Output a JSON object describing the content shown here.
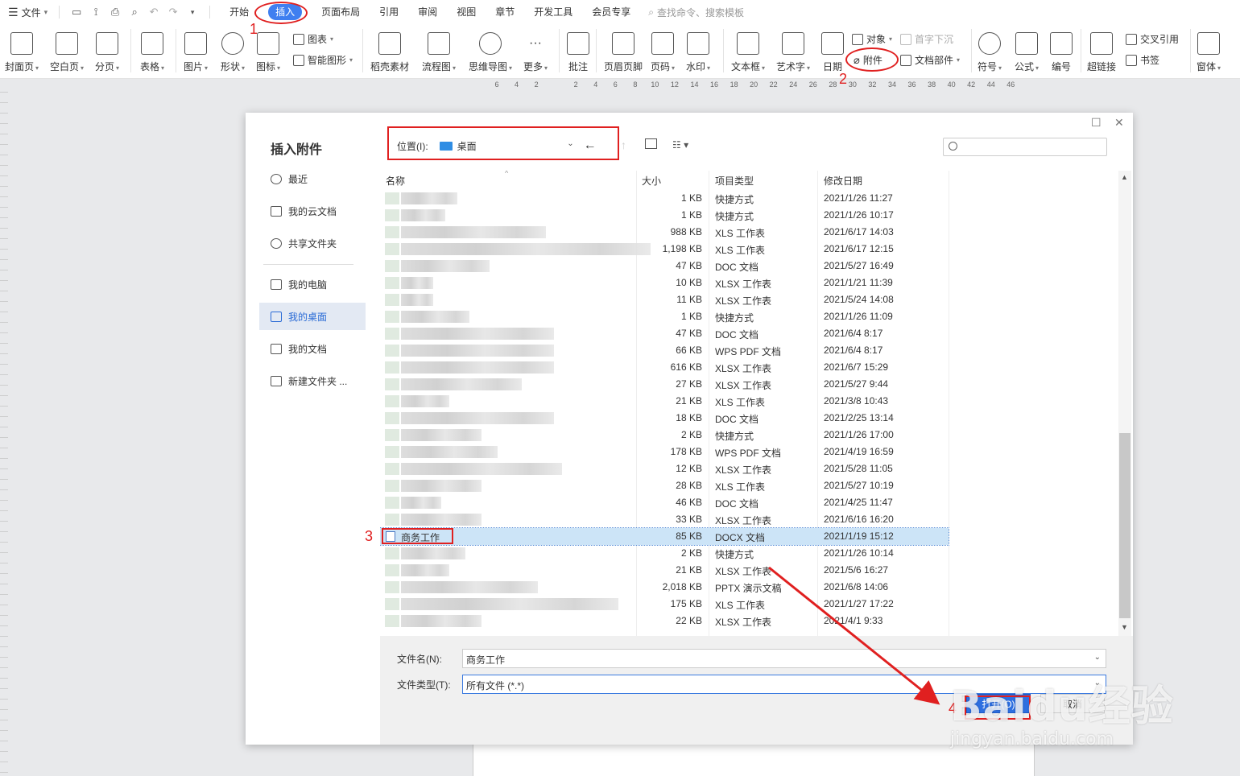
{
  "menubar": {
    "file_label": "文件",
    "tabs": [
      "开始",
      "插入",
      "页面布局",
      "引用",
      "审阅",
      "视图",
      "章节",
      "开发工具",
      "会员专享"
    ],
    "active_tab": "插入",
    "search_placeholder": "查找命令、搜索模板"
  },
  "ribbon": {
    "cover": "封面页",
    "blank": "空白页",
    "pagebreak": "分页",
    "table": "表格",
    "picture": "图片",
    "shape": "形状",
    "icon": "图标",
    "chart": "图表",
    "smartart": "智能图形",
    "material": "稻壳素材",
    "flowchart": "流程图",
    "mindmap": "思维导图",
    "more": "更多",
    "comment": "批注",
    "headerfooter": "页眉页脚",
    "pagenum": "页码",
    "watermark": "水印",
    "textbox": "文本框",
    "wordart": "艺术字",
    "date": "日期",
    "object": "对象",
    "attachment": "附件",
    "dropcap": "首字下沉",
    "docpart": "文档部件",
    "symbol": "符号",
    "formula": "公式",
    "numbering": "编号",
    "hyperlink": "超链接",
    "crossref": "交叉引用",
    "bookmark": "书签",
    "window": "窗体"
  },
  "ruler_ticks": [
    "6",
    "4",
    "2",
    "",
    "2",
    "4",
    "6",
    "8",
    "10",
    "12",
    "14",
    "16",
    "18",
    "20",
    "22",
    "24",
    "26",
    "28",
    "30",
    "32",
    "34",
    "36",
    "38",
    "40",
    "42",
    "44",
    "46"
  ],
  "annotations": [
    "1",
    "2",
    "3",
    "4"
  ],
  "dialog": {
    "title": "插入附件",
    "location_label": "位置(I):",
    "location_value": "桌面",
    "sidebar": [
      "最近",
      "我的云文档",
      "共享文件夹",
      "我的电脑",
      "我的桌面",
      "我的文档",
      "新建文件夹 ..."
    ],
    "columns": [
      "名称",
      "大小",
      "项目类型",
      "修改日期"
    ],
    "files": [
      {
        "size": "1 KB",
        "type": "快捷方式",
        "date": "2021/1/26 11:27"
      },
      {
        "size": "1 KB",
        "type": "快捷方式",
        "date": "2021/1/26 10:17"
      },
      {
        "size": "988 KB",
        "type": "XLS 工作表",
        "date": "2021/6/17 14:03"
      },
      {
        "size": "1,198 KB",
        "type": "XLS 工作表",
        "date": "2021/6/17 12:15"
      },
      {
        "size": "47 KB",
        "type": "DOC 文档",
        "date": "2021/5/27 16:49"
      },
      {
        "size": "10 KB",
        "type": "XLSX 工作表",
        "date": "2021/1/21 11:39"
      },
      {
        "size": "11 KB",
        "type": "XLSX 工作表",
        "date": "2021/5/24 14:08"
      },
      {
        "size": "1 KB",
        "type": "快捷方式",
        "date": "2021/1/26 11:09"
      },
      {
        "size": "47 KB",
        "type": "DOC 文档",
        "date": "2021/6/4 8:17"
      },
      {
        "size": "66 KB",
        "type": "WPS PDF 文档",
        "date": "2021/6/4 8:17"
      },
      {
        "size": "616 KB",
        "type": "XLSX 工作表",
        "date": "2021/6/7 15:29"
      },
      {
        "size": "27 KB",
        "type": "XLSX 工作表",
        "date": "2021/5/27 9:44"
      },
      {
        "size": "21 KB",
        "type": "XLS 工作表",
        "date": "2021/3/8 10:43"
      },
      {
        "size": "18 KB",
        "type": "DOC 文档",
        "date": "2021/2/25 13:14"
      },
      {
        "size": "2 KB",
        "type": "快捷方式",
        "date": "2021/1/26 17:00"
      },
      {
        "size": "178 KB",
        "type": "WPS PDF 文档",
        "date": "2021/4/19 16:59"
      },
      {
        "size": "12 KB",
        "type": "XLSX 工作表",
        "date": "2021/5/28 11:05"
      },
      {
        "size": "28 KB",
        "type": "XLS 工作表",
        "date": "2021/5/27 10:19"
      },
      {
        "size": "46 KB",
        "type": "DOC 文档",
        "date": "2021/4/25 11:47"
      },
      {
        "size": "33 KB",
        "type": "XLSX 工作表",
        "date": "2021/6/16 16:20"
      },
      {
        "name": "商务工作",
        "size": "85 KB",
        "type": "DOCX 文档",
        "date": "2021/1/19 15:12",
        "selected": true
      },
      {
        "size": "2 KB",
        "type": "快捷方式",
        "date": "2021/1/26 10:14"
      },
      {
        "size": "21 KB",
        "type": "XLSX 工作表",
        "date": "2021/5/6 16:27"
      },
      {
        "size": "2,018 KB",
        "type": "PPTX 演示文稿",
        "date": "2021/6/8 14:06"
      },
      {
        "size": "175 KB",
        "type": "XLS 工作表",
        "date": "2021/1/27 17:22"
      },
      {
        "size": "22 KB",
        "type": "XLSX 工作表",
        "date": "2021/4/1 9:33"
      }
    ],
    "filename_label": "文件名(N):",
    "filename_value": "商务工作",
    "filetype_label": "文件类型(T):",
    "filetype_value": "所有文件 (*.*)",
    "open_button": "打开(O)",
    "cancel_button": "取消"
  },
  "watermark": {
    "logo": "Baidu经验",
    "url": "jingyan.baidu.com"
  },
  "colors": {
    "accent": "#3f7ff0",
    "annotation": "#e02020",
    "selected_row": "#cce4f7"
  }
}
